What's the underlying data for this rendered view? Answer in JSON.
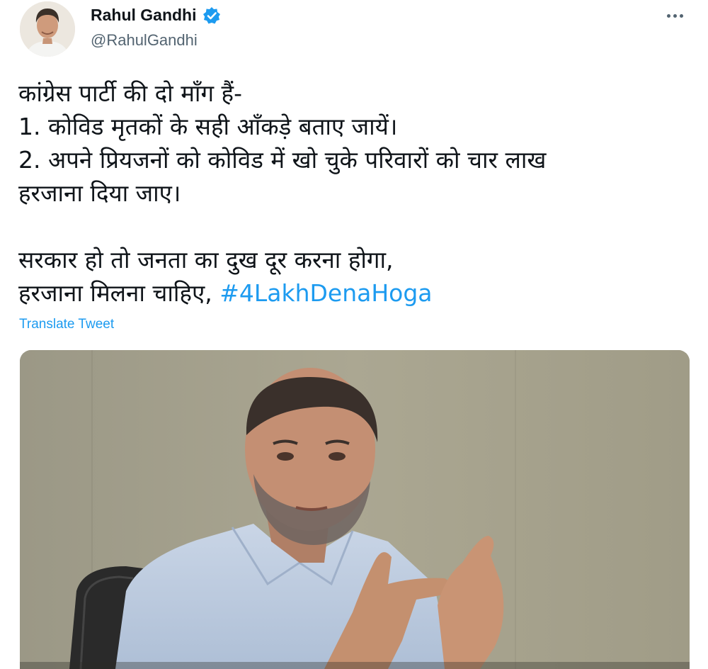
{
  "author": {
    "name": "Rahul Gandhi",
    "handle": "@RahulGandhi",
    "verified": true,
    "avatar_icon": "profile-photo"
  },
  "tweet": {
    "lines": [
      "कांग्रेस पार्टी की दो माँग हैं-",
      "1. कोविड मृतकों के सही आँकड़े बताए जायें।",
      "2. अपने प्रियजनों को कोविड में खो चुके परिवारों को चार लाख",
      "हरजाना दिया जाए।",
      "",
      "सरकार हो तो जनता का दुख दूर करना होगा,"
    ],
    "last_line_text": "हरजाना मिलना चाहिए, ",
    "hashtag": "#4LakhDenaHoga"
  },
  "translate_label": "Translate Tweet",
  "more_icon": "more-options-icon",
  "colors": {
    "accent": "#1d9bf0",
    "text": "#0f1419",
    "secondary": "#536471"
  }
}
